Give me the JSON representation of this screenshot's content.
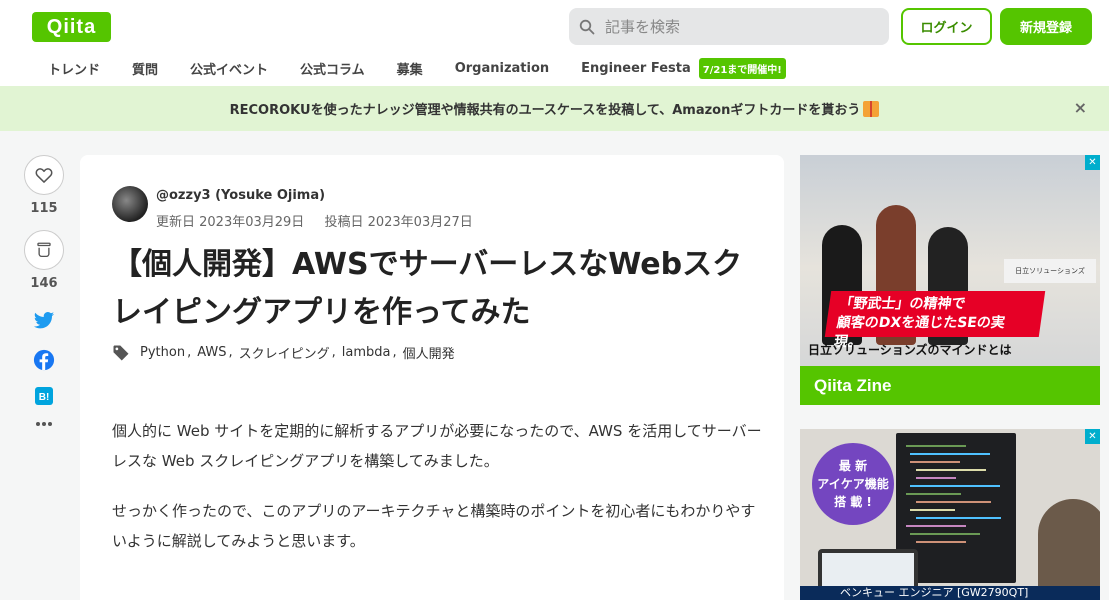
{
  "header": {
    "logo": "Qiita",
    "search_placeholder": "記事を検索",
    "login_label": "ログイン",
    "signup_label": "新規登録"
  },
  "nav": {
    "items": [
      "トレンド",
      "質問",
      "公式イベント",
      "公式コラム",
      "募集",
      "Organization",
      "Engineer Festa"
    ],
    "badge": "7/21まで開催中!"
  },
  "banner": {
    "text": "RECOROKUを使ったナレッジ管理や情報共有のユースケースを投稿して、Amazonギフトカードを貰おう",
    "close": "×"
  },
  "rail": {
    "likes": "115",
    "stocks": "146"
  },
  "article": {
    "author": "@ozzy3 (Yosuke Ojima)",
    "updated": "更新日 2023年03月29日",
    "posted": "投稿日 2023年03月27日",
    "title": "【個人開発】AWSでサーバーレスなWebスクレイピングアプリを作ってみた",
    "tags": [
      "Python",
      "AWS",
      "スクレイピング",
      "lambda",
      "個人開発"
    ],
    "paragraph1": "個人的に Web サイトを定期的に解析するアプリが必要になったので、AWS を活用してサーバーレスな Web スクレイピングアプリを構築してみました。",
    "paragraph2": "せっかく作ったので、このアプリのアーキテクチャと構築時のポイントを初心者にもわかりやすいように解説してみようと思います。"
  },
  "ads": {
    "ad1_headline_1": "「野武士」の精神で",
    "ad1_headline_2": "顧客のDXを通じたSEの実現。",
    "ad1_caption": "日立ソリューションズのマインドとは",
    "ad1_sign": "日立ソリューションズ",
    "ad1_footer": "Qiita Zine",
    "ad2_badge": "最 新\nアイケア機能\n搭 載 !",
    "ad2_caption": "ベンキュー エンジニア [GW2790QT]"
  },
  "colors": {
    "brand": "#55c500",
    "banner_bg": "#e1f4d3",
    "ad_red": "#e60026",
    "ad_purple": "#7446c0"
  }
}
